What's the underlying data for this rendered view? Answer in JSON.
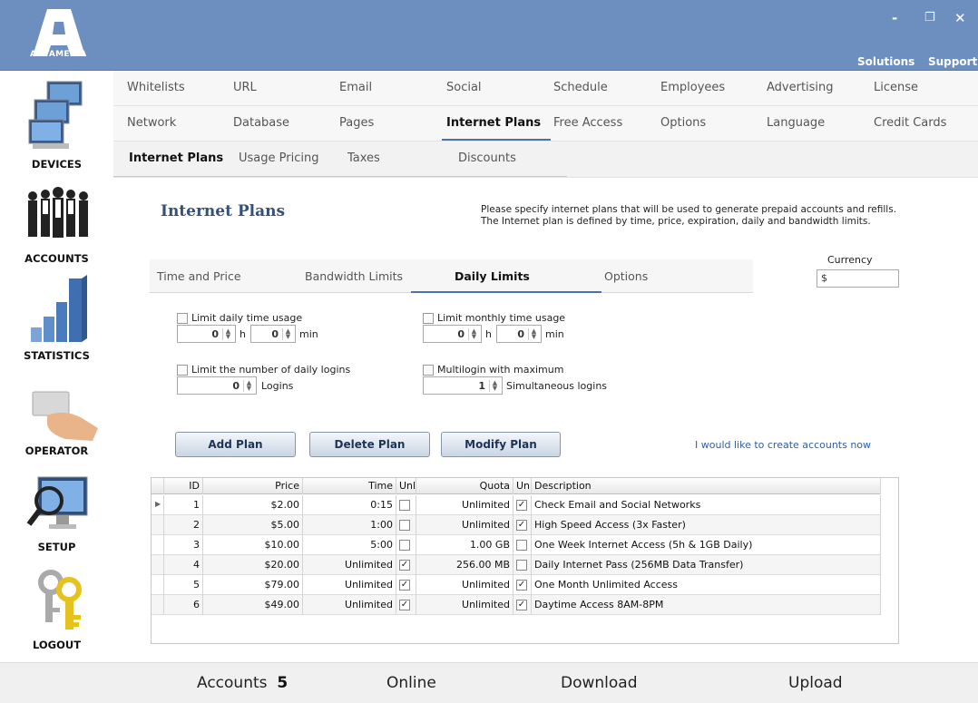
{
  "app": {
    "logo_text": "ANTAMEDIA",
    "header_links": [
      "Solutions",
      "Support"
    ],
    "window_controls": {
      "minimize": "-",
      "restore": "❐",
      "close": "✕"
    }
  },
  "sidebar": [
    {
      "label": "DEVICES",
      "icon": "computers-icon"
    },
    {
      "label": "ACCOUNTS",
      "icon": "people-icon"
    },
    {
      "label": "STATISTICS",
      "icon": "bar-chart-icon"
    },
    {
      "label": "OPERATOR",
      "icon": "card-hand-icon"
    },
    {
      "label": "SETUP",
      "icon": "monitor-magnifier-icon"
    },
    {
      "label": "LOGOUT",
      "icon": "keys-icon"
    }
  ],
  "nav_row1": [
    "Whitelists",
    "URL",
    "Email",
    "Social",
    "Schedule",
    "Employees",
    "Advertising",
    "License"
  ],
  "nav_row2": [
    "Network",
    "Database",
    "Pages",
    "Internet Plans",
    "Free Access",
    "Options",
    "Language",
    "Credit Cards"
  ],
  "nav_row3": [
    "Internet Plans",
    "Usage Pricing",
    "Taxes",
    "Discounts"
  ],
  "page": {
    "title": "Internet Plans",
    "description_line1": "Please specify internet plans that will be used to generate prepaid accounts and refills.",
    "description_line2": "The Internet plan is defined by time, price, expiration, daily and bandwidth limits."
  },
  "plan_tabs": [
    "Time and Price",
    "Bandwidth Limits",
    "Daily Limits",
    "Options"
  ],
  "currency": {
    "label": "Currency",
    "value": "$"
  },
  "limits": {
    "daily_time": {
      "label": "Limit daily time usage",
      "hours": "0",
      "h": "h",
      "minutes": "0",
      "min": "min"
    },
    "monthly_time": {
      "label": "Limit monthly time usage",
      "hours": "0",
      "h": "h",
      "minutes": "0",
      "min": "min"
    },
    "daily_logins": {
      "label": "Limit the number of daily logins",
      "value": "0",
      "unit": "Logins"
    },
    "multilogin": {
      "label": "Multilogin with maximum",
      "value": "1",
      "unit": "Simultaneous logins"
    }
  },
  "buttons": {
    "add": "Add Plan",
    "delete": "Delete Plan",
    "modify": "Modify Plan"
  },
  "create_link": "I would like to create accounts now",
  "grid": {
    "columns": [
      "ID",
      "Price",
      "Time",
      "Unl",
      "Quota",
      "Unl",
      "Description"
    ],
    "rows": [
      {
        "id": "1",
        "price": "$2.00",
        "time": "0:15",
        "time_unl": "",
        "quota": "Unlimited",
        "quota_unl": "✓",
        "desc": "Check Email and Social Networks"
      },
      {
        "id": "2",
        "price": "$5.00",
        "time": "1:00",
        "time_unl": "",
        "quota": "Unlimited",
        "quota_unl": "✓",
        "desc": "High Speed Access (3x Faster)"
      },
      {
        "id": "3",
        "price": "$10.00",
        "time": "5:00",
        "time_unl": "",
        "quota": "1.00 GB",
        "quota_unl": "",
        "desc": "One Week Internet Access (5h & 1GB Daily)"
      },
      {
        "id": "4",
        "price": "$20.00",
        "time": "Unlimited",
        "time_unl": "✓",
        "quota": "256.00 MB",
        "quota_unl": "",
        "desc": "Daily Internet Pass (256MB Data Transfer)"
      },
      {
        "id": "5",
        "price": "$79.00",
        "time": "Unlimited",
        "time_unl": "✓",
        "quota": "Unlimited",
        "quota_unl": "✓",
        "desc": "One Month Unlimited Access"
      },
      {
        "id": "6",
        "price": "$49.00",
        "time": "Unlimited",
        "time_unl": "✓",
        "quota": "Unlimited",
        "quota_unl": "✓",
        "desc": "Daytime Access 8AM-8PM"
      }
    ]
  },
  "footer": {
    "accounts_label": "Accounts",
    "accounts_count": "5",
    "online": "Online",
    "download": "Download",
    "upload": "Upload"
  },
  "colors": {
    "header": "#6c8fbf",
    "accent": "#4b73a8",
    "title": "#34507c"
  }
}
